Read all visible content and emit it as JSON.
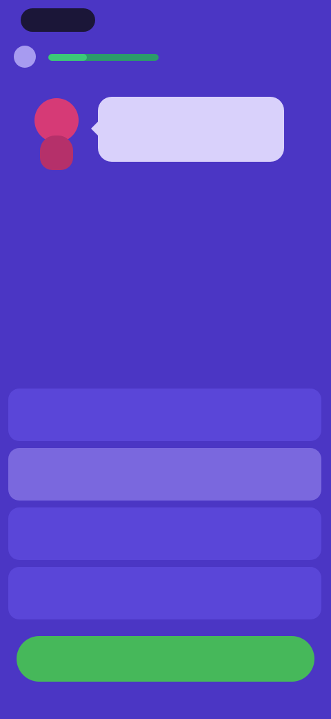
{
  "progress": 0.35,
  "bubble": {
    "text": ""
  },
  "options": [
    {
      "label": "",
      "selected": false
    },
    {
      "label": "",
      "selected": true
    },
    {
      "label": "",
      "selected": false
    },
    {
      "label": "",
      "selected": false
    }
  ],
  "continue_label": "",
  "colors": {
    "background": "#4b36c4",
    "accent_green": "#46b85a",
    "progress": "#3cc878",
    "bubble": "#d9d1fb",
    "mascot": "#d63a76"
  }
}
